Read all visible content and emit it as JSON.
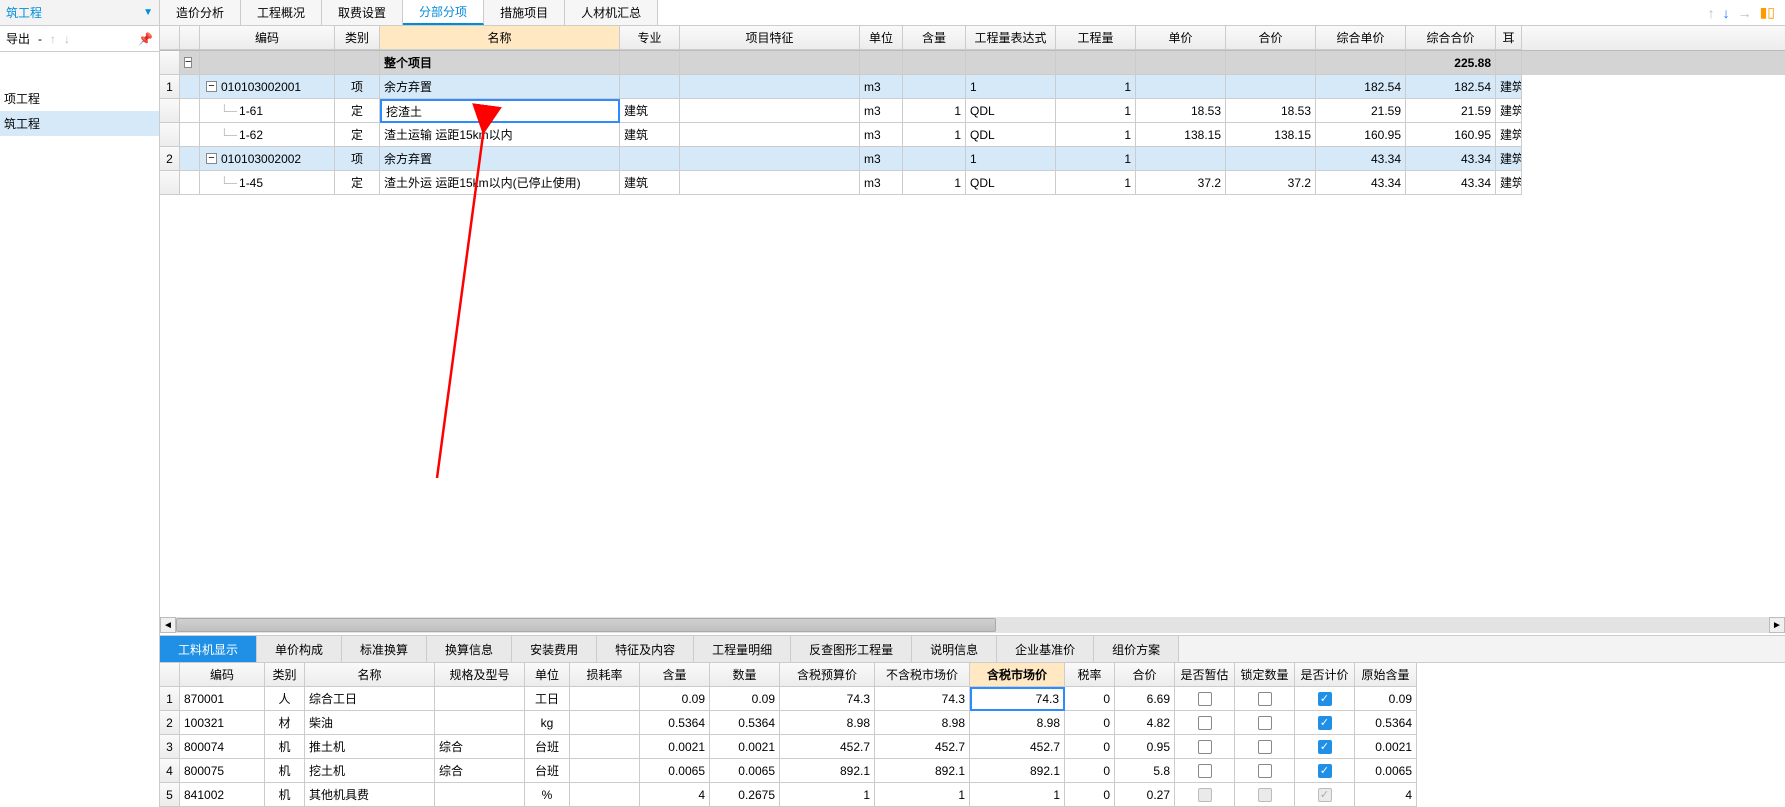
{
  "left": {
    "title": "筑工程",
    "export": "导出",
    "items": [
      "项工程",
      "筑工程"
    ],
    "selected": 1
  },
  "tabs": {
    "items": [
      "造价分析",
      "工程概况",
      "取费设置",
      "分部分项",
      "措施项目",
      "人材机汇总"
    ],
    "active": 3
  },
  "topGrid": {
    "headers": {
      "code": "编码",
      "cat": "类别",
      "name": "名称",
      "spec": "专业",
      "feat": "项目特征",
      "unit": "单位",
      "content": "含量",
      "expr": "工程量表达式",
      "qty": "工程量",
      "price": "单价",
      "total": "合价",
      "cprice": "综合单价",
      "ctotal": "综合合价",
      "last": "耳"
    },
    "titleRow": {
      "name": "整个项目",
      "ctotal": "225.88"
    },
    "rows": [
      {
        "idx": "1",
        "code": "010103002001",
        "cat": "项",
        "name": "余方弃置",
        "spec": "",
        "unit": "m3",
        "content": "",
        "expr": "1",
        "qty": "1",
        "price": "",
        "total": "",
        "cprice": "182.54",
        "ctotal": "182.54",
        "last": "建筑",
        "highlight": true,
        "indent": 0,
        "box": true
      },
      {
        "idx": "",
        "code": "1-61",
        "cat": "定",
        "name": "挖渣土",
        "spec": "建筑",
        "unit": "m3",
        "content": "1",
        "expr": "QDL",
        "qty": "1",
        "price": "18.53",
        "total": "18.53",
        "cprice": "21.59",
        "ctotal": "21.59",
        "last": "建筑",
        "editing": true,
        "indent": 1
      },
      {
        "idx": "",
        "code": "1-62",
        "cat": "定",
        "name": "渣土运输 运距15km以内",
        "spec": "建筑",
        "unit": "m3",
        "content": "1",
        "expr": "QDL",
        "qty": "1",
        "price": "138.15",
        "total": "138.15",
        "cprice": "160.95",
        "ctotal": "160.95",
        "last": "建筑",
        "indent": 1
      },
      {
        "idx": "2",
        "code": "010103002002",
        "cat": "项",
        "name": "余方弃置",
        "spec": "",
        "unit": "m3",
        "content": "",
        "expr": "1",
        "qty": "1",
        "price": "",
        "total": "",
        "cprice": "43.34",
        "ctotal": "43.34",
        "last": "建筑",
        "highlight": true,
        "indent": 0,
        "box": true
      },
      {
        "idx": "",
        "code": "1-45",
        "cat": "定",
        "name": "渣土外运 运距15km以内(已停止使用)",
        "spec": "建筑",
        "unit": "m3",
        "content": "1",
        "expr": "QDL",
        "qty": "1",
        "price": "37.2",
        "total": "37.2",
        "cprice": "43.34",
        "ctotal": "43.34",
        "last": "建筑",
        "indent": 1
      }
    ]
  },
  "bottomTabs": {
    "items": [
      "工料机显示",
      "单价构成",
      "标准换算",
      "换算信息",
      "安装费用",
      "特征及内容",
      "工程量明细",
      "反查图形工程量",
      "说明信息",
      "企业基准价",
      "组价方案"
    ],
    "active": 0
  },
  "bottomGrid": {
    "headers": {
      "code": "编码",
      "cat": "类别",
      "name": "名称",
      "model": "规格及型号",
      "unit": "单位",
      "loss": "损耗率",
      "content": "含量",
      "qty": "数量",
      "budget": "含税预算价",
      "notax": "不含税市场价",
      "tax": "含税市场价",
      "rate": "税率",
      "total": "合价",
      "tmp": "是否暂估",
      "lock": "锁定数量",
      "calc": "是否计价",
      "orig": "原始含量"
    },
    "rows": [
      {
        "idx": "1",
        "code": "870001",
        "cat": "人",
        "name": "综合工日",
        "model": "",
        "unit": "工日",
        "loss": "",
        "content": "0.09",
        "qty": "0.09",
        "budget": "74.3",
        "notax": "74.3",
        "tax": "74.3",
        "rate": "0",
        "total": "6.69",
        "tmp": false,
        "lock": false,
        "calc": true,
        "orig": "0.09",
        "sel": true
      },
      {
        "idx": "2",
        "code": "100321",
        "cat": "材",
        "name": "柴油",
        "model": "",
        "unit": "kg",
        "loss": "",
        "content": "0.5364",
        "qty": "0.5364",
        "budget": "8.98",
        "notax": "8.98",
        "tax": "8.98",
        "rate": "0",
        "total": "4.82",
        "tmp": false,
        "lock": false,
        "calc": true,
        "orig": "0.5364"
      },
      {
        "idx": "3",
        "code": "800074",
        "cat": "机",
        "name": "推土机",
        "model": "综合",
        "unit": "台班",
        "loss": "",
        "content": "0.0021",
        "qty": "0.0021",
        "budget": "452.7",
        "notax": "452.7",
        "tax": "452.7",
        "rate": "0",
        "total": "0.95",
        "tmp": false,
        "lock": false,
        "calc": true,
        "orig": "0.0021"
      },
      {
        "idx": "4",
        "code": "800075",
        "cat": "机",
        "name": "挖土机",
        "model": "综合",
        "unit": "台班",
        "loss": "",
        "content": "0.0065",
        "qty": "0.0065",
        "budget": "892.1",
        "notax": "892.1",
        "tax": "892.1",
        "rate": "0",
        "total": "5.8",
        "tmp": false,
        "lock": false,
        "calc": true,
        "orig": "0.0065"
      },
      {
        "idx": "5",
        "code": "841002",
        "cat": "机",
        "name": "其他机具费",
        "model": "",
        "unit": "%",
        "loss": "",
        "content": "4",
        "qty": "0.2675",
        "budget": "1",
        "notax": "1",
        "tax": "1",
        "rate": "0",
        "total": "0.27",
        "tmp": false,
        "tmpdis": true,
        "lock": false,
        "lockdis": true,
        "calc": true,
        "calcdis": true,
        "orig": "4"
      }
    ]
  }
}
